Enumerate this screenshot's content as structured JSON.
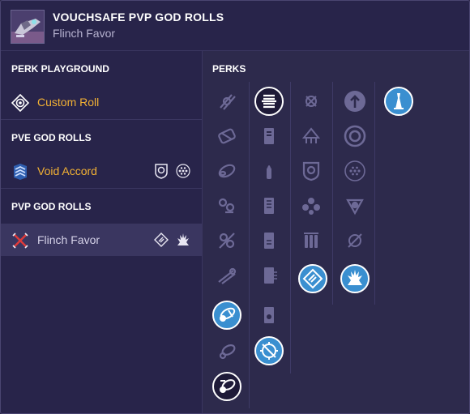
{
  "header": {
    "title": "VOUCHSAFE PVP GOD ROLLS",
    "subtitle": "Flinch Favor",
    "weapon_icon": "weapon-thumbnail"
  },
  "sidebar": {
    "sections": [
      {
        "title": "PERK PLAYGROUND",
        "items": [
          {
            "label": "Custom Roll",
            "icon": "target-icon",
            "badges": []
          }
        ]
      },
      {
        "title": "PVE GOD ROLLS",
        "items": [
          {
            "label": "Void Accord",
            "icon": "chevron-rank-icon",
            "badges": [
              "barrel-perk-icon",
              "dots-perk-icon"
            ]
          }
        ]
      },
      {
        "title": "PVP GOD ROLLS",
        "items": [
          {
            "label": "Flinch Favor",
            "icon": "crossed-swords-icon",
            "badges": [
              "diamond-perk-icon",
              "burst-perk-icon"
            ]
          }
        ]
      }
    ]
  },
  "perks": {
    "title": "PERKS",
    "columns": [
      {
        "name": "barrels",
        "count": 9,
        "selected_index": 5
      },
      {
        "name": "magazines",
        "count": 8,
        "selected_index": 0
      },
      {
        "name": "trait-1",
        "count": 6,
        "selected_index": 5
      },
      {
        "name": "trait-2",
        "count": 6,
        "selected_index": 5
      },
      {
        "name": "origin",
        "count": 1,
        "selected_index": 0
      }
    ]
  },
  "colors": {
    "background": "#2d2a4c",
    "panel": "#28244a",
    "accent_gold": "#f2b134",
    "selected_perk": "#3a8fd0"
  }
}
